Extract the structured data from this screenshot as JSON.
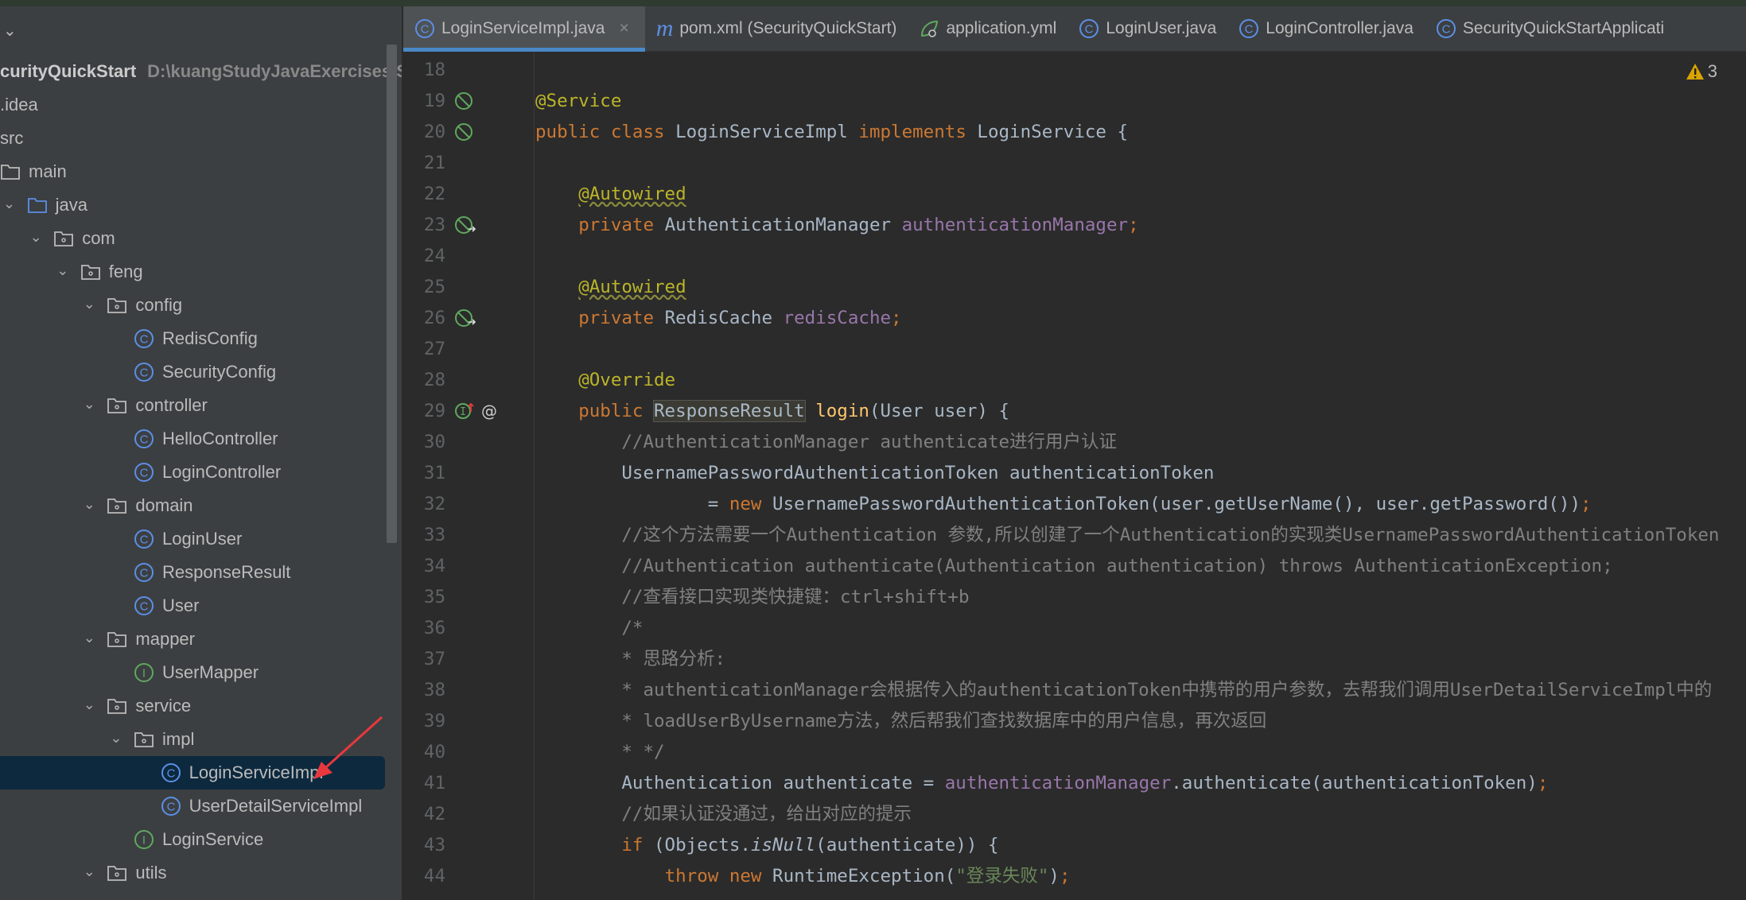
{
  "sidebar": {
    "project_name": "curityQuickStart",
    "project_path": "D:\\kuangStudyJavaExercises\\Se",
    "items": [
      {
        "label": ".idea",
        "depth": 0,
        "type": "text"
      },
      {
        "label": "src",
        "depth": 0,
        "type": "text"
      },
      {
        "label": "main",
        "depth": 1,
        "type": "folder",
        "open": false
      },
      {
        "label": "java",
        "depth": 2,
        "type": "folder-blue",
        "open": true
      },
      {
        "label": "com",
        "depth": 3,
        "type": "package",
        "open": true
      },
      {
        "label": "feng",
        "depth": 4,
        "type": "package",
        "open": true
      },
      {
        "label": "config",
        "depth": 5,
        "type": "package",
        "open": true
      },
      {
        "label": "RedisConfig",
        "depth": 6,
        "type": "class"
      },
      {
        "label": "SecurityConfig",
        "depth": 6,
        "type": "class"
      },
      {
        "label": "controller",
        "depth": 5,
        "type": "package",
        "open": true
      },
      {
        "label": "HelloController",
        "depth": 6,
        "type": "class"
      },
      {
        "label": "LoginController",
        "depth": 6,
        "type": "class"
      },
      {
        "label": "domain",
        "depth": 5,
        "type": "package",
        "open": true
      },
      {
        "label": "LoginUser",
        "depth": 6,
        "type": "class"
      },
      {
        "label": "ResponseResult",
        "depth": 6,
        "type": "class"
      },
      {
        "label": "User",
        "depth": 6,
        "type": "class"
      },
      {
        "label": "mapper",
        "depth": 5,
        "type": "package",
        "open": true
      },
      {
        "label": "UserMapper",
        "depth": 6,
        "type": "interface"
      },
      {
        "label": "service",
        "depth": 5,
        "type": "package",
        "open": true
      },
      {
        "label": "impl",
        "depth": 6,
        "type": "package",
        "open": true
      },
      {
        "label": "LoginServiceImpl",
        "depth": 7,
        "type": "class",
        "selected": true
      },
      {
        "label": "UserDetailServiceImpl",
        "depth": 7,
        "type": "class"
      },
      {
        "label": "LoginService",
        "depth": 6,
        "type": "interface"
      },
      {
        "label": "utils",
        "depth": 5,
        "type": "package",
        "open": true
      }
    ]
  },
  "tabs": [
    {
      "label": "LoginServiceImpl.java",
      "icon": "class-icon",
      "active": true
    },
    {
      "label": "pom.xml (SecurityQuickStart)",
      "icon": "maven-icon"
    },
    {
      "label": "application.yml",
      "icon": "spring-icon"
    },
    {
      "label": "LoginUser.java",
      "icon": "class-icon"
    },
    {
      "label": "LoginController.java",
      "icon": "class-icon"
    },
    {
      "label": "SecurityQuickStartApplicati",
      "icon": "class-icon"
    }
  ],
  "editor": {
    "warning_count": "3",
    "lines": [
      {
        "n": "18",
        "t": []
      },
      {
        "n": "19",
        "g": "bean",
        "t": [
          [
            "an",
            "@Service"
          ]
        ]
      },
      {
        "n": "20",
        "g": "bean",
        "t": [
          [
            "kw",
            "public class "
          ],
          [
            "",
            "LoginServiceImpl "
          ],
          [
            "kw",
            "implements "
          ],
          [
            "",
            "LoginService {"
          ]
        ]
      },
      {
        "n": "21",
        "t": []
      },
      {
        "n": "22",
        "t": [
          [
            "",
            "    "
          ],
          [
            "an wavy",
            "@Autowired"
          ]
        ]
      },
      {
        "n": "23",
        "g": "inject",
        "t": [
          [
            "",
            "    "
          ],
          [
            "kw",
            "private "
          ],
          [
            "",
            "AuthenticationManager "
          ],
          [
            "fd",
            "authenticationManager"
          ],
          [
            "kw",
            ";"
          ]
        ]
      },
      {
        "n": "24",
        "t": []
      },
      {
        "n": "25",
        "t": [
          [
            "",
            "    "
          ],
          [
            "an wavy",
            "@Autowired"
          ]
        ]
      },
      {
        "n": "26",
        "g": "inject",
        "t": [
          [
            "",
            "    "
          ],
          [
            "kw",
            "private "
          ],
          [
            "",
            "RedisCache "
          ],
          [
            "fd",
            "redisCache"
          ],
          [
            "kw",
            ";"
          ]
        ]
      },
      {
        "n": "27",
        "t": []
      },
      {
        "n": "28",
        "t": [
          [
            "",
            "    "
          ],
          [
            "an",
            "@Override"
          ]
        ]
      },
      {
        "n": "29",
        "g": "override",
        "t": [
          [
            "",
            "    "
          ],
          [
            "kw",
            "public "
          ],
          [
            "hl",
            "ResponseResult"
          ],
          [
            "",
            " "
          ],
          [
            "mt",
            "login"
          ],
          [
            "",
            "(User user) {"
          ]
        ]
      },
      {
        "n": "30",
        "t": [
          [
            "",
            "        "
          ],
          [
            "cm",
            "//AuthenticationManager authenticate进行用户认证"
          ]
        ]
      },
      {
        "n": "31",
        "t": [
          [
            "",
            "        UsernamePasswordAuthenticationToken authenticationToken"
          ]
        ]
      },
      {
        "n": "32",
        "t": [
          [
            "",
            "                = "
          ],
          [
            "kw",
            "new "
          ],
          [
            "",
            "UsernamePasswordAuthenticationToken(user.getUserName(), user.getPassword())"
          ],
          [
            "kw",
            ";"
          ]
        ]
      },
      {
        "n": "33",
        "t": [
          [
            "",
            "        "
          ],
          [
            "cm",
            "//这个方法需要一个Authentication 参数,所以创建了一个Authentication的实现类UsernamePasswordAuthenticationToken"
          ]
        ]
      },
      {
        "n": "34",
        "t": [
          [
            "",
            "        "
          ],
          [
            "cm",
            "//Authentication authenticate(Authentication authentication) throws AuthenticationException;"
          ]
        ]
      },
      {
        "n": "35",
        "t": [
          [
            "",
            "        "
          ],
          [
            "cm",
            "//查看接口实现类快捷键：ctrl+shift+b"
          ]
        ]
      },
      {
        "n": "36",
        "t": [
          [
            "",
            "        "
          ],
          [
            "cm",
            "/*"
          ]
        ]
      },
      {
        "n": "37",
        "t": [
          [
            "",
            "        "
          ],
          [
            "cm",
            "* 思路分析:"
          ]
        ]
      },
      {
        "n": "38",
        "t": [
          [
            "",
            "        "
          ],
          [
            "cm",
            "* authenticationManager会根据传入的authenticationToken中携带的用户参数，去帮我们调用UserDetailServiceImpl中的"
          ]
        ]
      },
      {
        "n": "39",
        "t": [
          [
            "",
            "        "
          ],
          [
            "cm",
            "* loadUserByUsername方法，然后帮我们查找数据库中的用户信息，再次返回"
          ]
        ]
      },
      {
        "n": "40",
        "t": [
          [
            "",
            "        "
          ],
          [
            "cm",
            "* */"
          ]
        ]
      },
      {
        "n": "41",
        "t": [
          [
            "",
            "        Authentication authenticate = "
          ],
          [
            "fd",
            "authenticationManager"
          ],
          [
            "",
            ".authenticate(authenticationToken)"
          ],
          [
            "kw",
            ";"
          ]
        ]
      },
      {
        "n": "42",
        "t": [
          [
            "",
            "        "
          ],
          [
            "cm",
            "//如果认证没通过，给出对应的提示"
          ]
        ]
      },
      {
        "n": "43",
        "t": [
          [
            "",
            "        "
          ],
          [
            "kw",
            "if "
          ],
          [
            "",
            "(Objects."
          ],
          [
            "it",
            "isNull"
          ],
          [
            "",
            "(authenticate)) {"
          ]
        ]
      },
      {
        "n": "44",
        "t": [
          [
            "",
            "            "
          ],
          [
            "kw",
            "throw new "
          ],
          [
            "",
            "RuntimeException("
          ],
          [
            "st",
            "\"登录失败\""
          ],
          [
            "",
            ")"
          ],
          [
            "kw",
            ";"
          ]
        ]
      }
    ]
  },
  "colors": {
    "accent": "#4a88c7",
    "selection": "#0d293e",
    "keyword": "#cc7832",
    "annotation": "#bbb529",
    "field": "#9876aa",
    "comment": "#808080",
    "method": "#ffc66d",
    "arrow": "#e8383d"
  }
}
